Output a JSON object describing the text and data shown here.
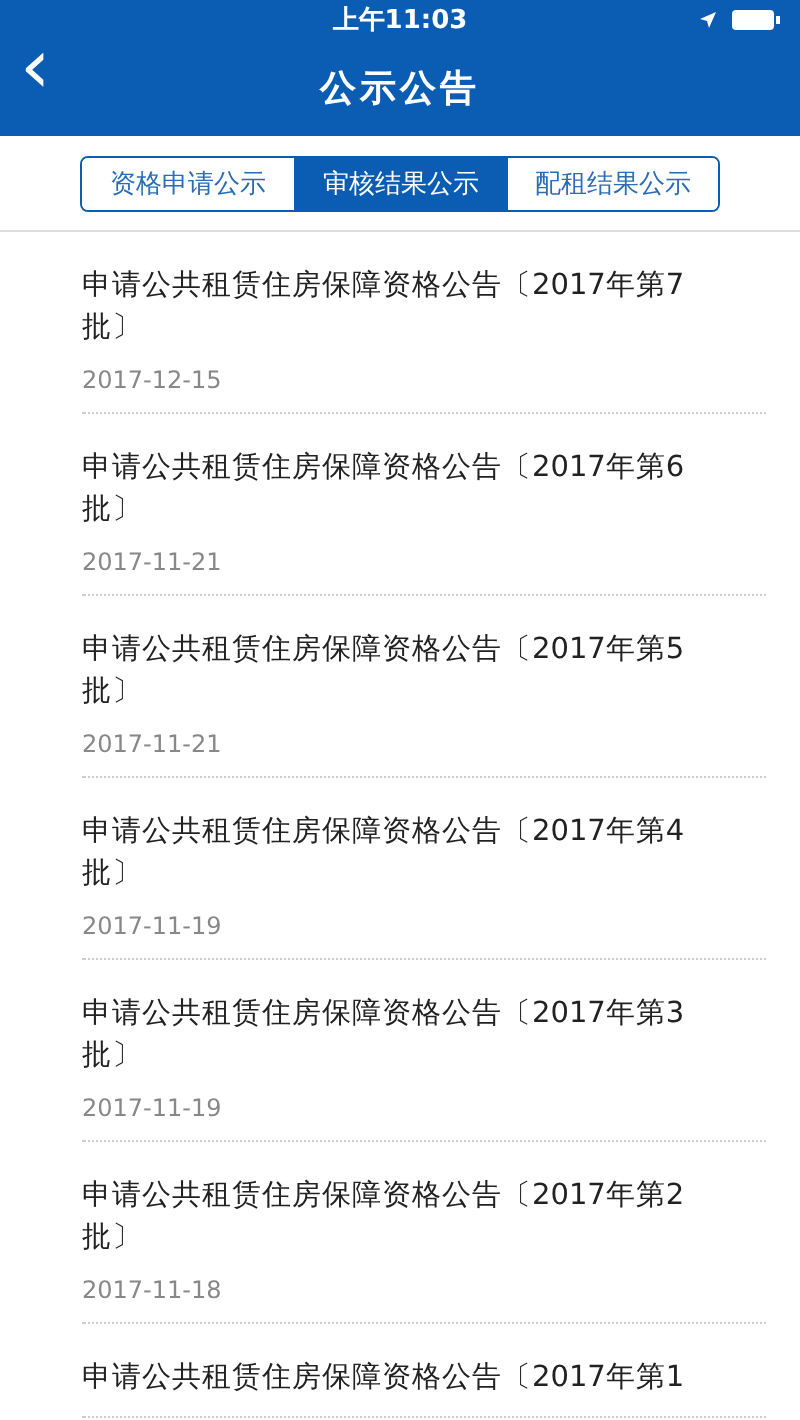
{
  "status_bar": {
    "time": "上午11:03"
  },
  "nav": {
    "back": "‹",
    "title": "公示公告"
  },
  "tabs": [
    {
      "label": "资格申请公示",
      "selected": false
    },
    {
      "label": "审核结果公示",
      "selected": true
    },
    {
      "label": "配租结果公示",
      "selected": false
    }
  ],
  "items": [
    {
      "title": "申请公共租赁住房保障资格公告〔2017年第7批〕",
      "date": "2017-12-15"
    },
    {
      "title": "申请公共租赁住房保障资格公告〔2017年第6批〕",
      "date": "2017-11-21"
    },
    {
      "title": "申请公共租赁住房保障资格公告〔2017年第5批〕",
      "date": "2017-11-21"
    },
    {
      "title": "申请公共租赁住房保障资格公告〔2017年第4批〕",
      "date": "2017-11-19"
    },
    {
      "title": "申请公共租赁住房保障资格公告〔2017年第3批〕",
      "date": "2017-11-19"
    },
    {
      "title": "申请公共租赁住房保障资格公告〔2017年第2批〕",
      "date": "2017-11-18"
    },
    {
      "title": "申请公共租赁住房保障资格公告〔2017年第1"
    }
  ]
}
